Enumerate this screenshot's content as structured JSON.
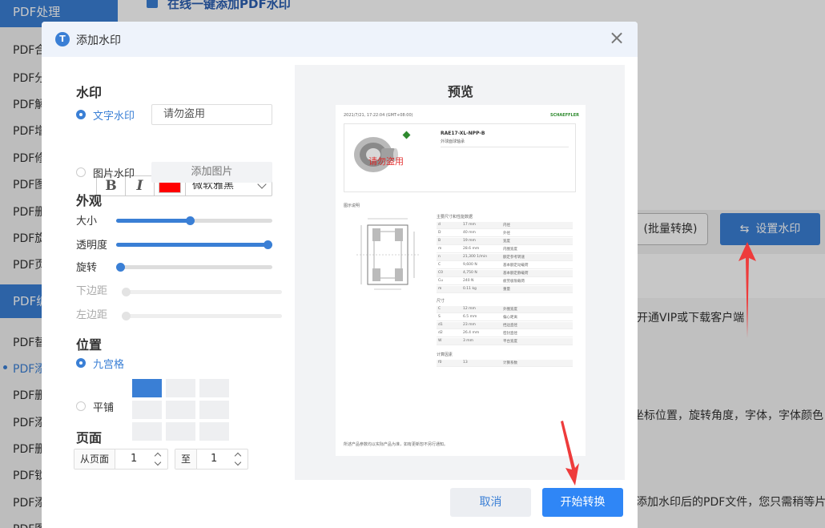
{
  "background": {
    "sidebar_header": "PDF处理",
    "sidebar_items_group1": [
      "PDF合",
      "PDF分",
      "PDF解",
      "PDF增",
      "PDF修",
      "PDF图",
      "PDF删",
      "PDF旋",
      "PDF页"
    ],
    "sidebar_header2": "PDF编",
    "sidebar_items_group2": [
      "PDF替",
      "PDF添",
      "PDF删",
      "PDF添",
      "PDF删",
      "PDF锁",
      "PDF添",
      "PDF图"
    ],
    "page_title": "在线一键添加PDF水印",
    "batch_button": "(批量转换)",
    "set_watermark_button": "设置水印",
    "text_vip": "开通VIP或下载客户端",
    "text_options": "坐标位置，旋转角度，字体，字体颜色",
    "text_wait": "添加水印后的PDF文件，您只需稍等片"
  },
  "dialog": {
    "title": "添加水印",
    "icon_letter": "T",
    "close": "×"
  },
  "watermark": {
    "section": "水印",
    "text_option": "文字水印",
    "text_value": "请勿盗用",
    "bold": "B",
    "italic": "I",
    "color": "#ff0000",
    "font": "微软雅黑",
    "image_option": "图片水印",
    "add_image": "添加图片"
  },
  "appearance": {
    "section": "外观",
    "size_label": "大小",
    "size_value": 0.47,
    "opacity_label": "透明度",
    "opacity_value": 1.0,
    "rotate_label": "旋转",
    "rotate_value": 0.0,
    "bottom_margin_label": "下边距",
    "left_margin_label": "左边距"
  },
  "position": {
    "section": "位置",
    "grid_option": "九宫格",
    "tile_option": "平铺",
    "selected_cell": 0
  },
  "pages": {
    "section": "页面",
    "from_label": "从页面",
    "from_value": "1",
    "to_label": "至",
    "to_value": "1"
  },
  "preview": {
    "title": "预览",
    "timestamp": "2021/7/21, 17:22:04 (GMT+08:00)",
    "brand": "SCHAEFFLER",
    "product_name": "RAE17-XL-NPP-B",
    "product_sub": "外球面球轴承",
    "watermark_text": "请勿盗用",
    "section_dim": "图示说明",
    "section_main": "主要尺寸和性能数据",
    "section_size": "尺寸",
    "section_calc": "计算因素",
    "table_rows": [
      [
        "d",
        "17 mm",
        "内径"
      ],
      [
        "D",
        "40 mm",
        "外径"
      ],
      [
        "B",
        "19 mm",
        "宽度"
      ],
      [
        "m",
        "28.6 mm",
        "内圈宽度"
      ],
      [
        "n",
        "21,300 1/min",
        "额定参考转速"
      ],
      [
        "C",
        "9,600 N",
        "基本额定动载荷"
      ],
      [
        "C0",
        "4,750 N",
        "基本额定静载荷"
      ],
      [
        "Cu",
        "240 N",
        "疲劳极限载荷"
      ],
      [
        "m",
        "0.11 kg",
        "重量"
      ]
    ],
    "size_rows": [
      [
        "C",
        "12 mm",
        "外圈宽度"
      ],
      [
        "S",
        "6.5 mm",
        "偏心距离"
      ],
      [
        "d1",
        "23 mm",
        "挡边直径"
      ],
      [
        "d2",
        "26.4 mm",
        "密封直径"
      ],
      [
        "W",
        "3 mm",
        "平台宽度"
      ]
    ],
    "calc_rows": [
      [
        "f0",
        "13",
        "计算系数"
      ]
    ],
    "footer_note": "所述产品参数均以实际产品为准，如有更新恕不另行通知。"
  },
  "footer": {
    "cancel": "取消",
    "start": "开始转换"
  }
}
